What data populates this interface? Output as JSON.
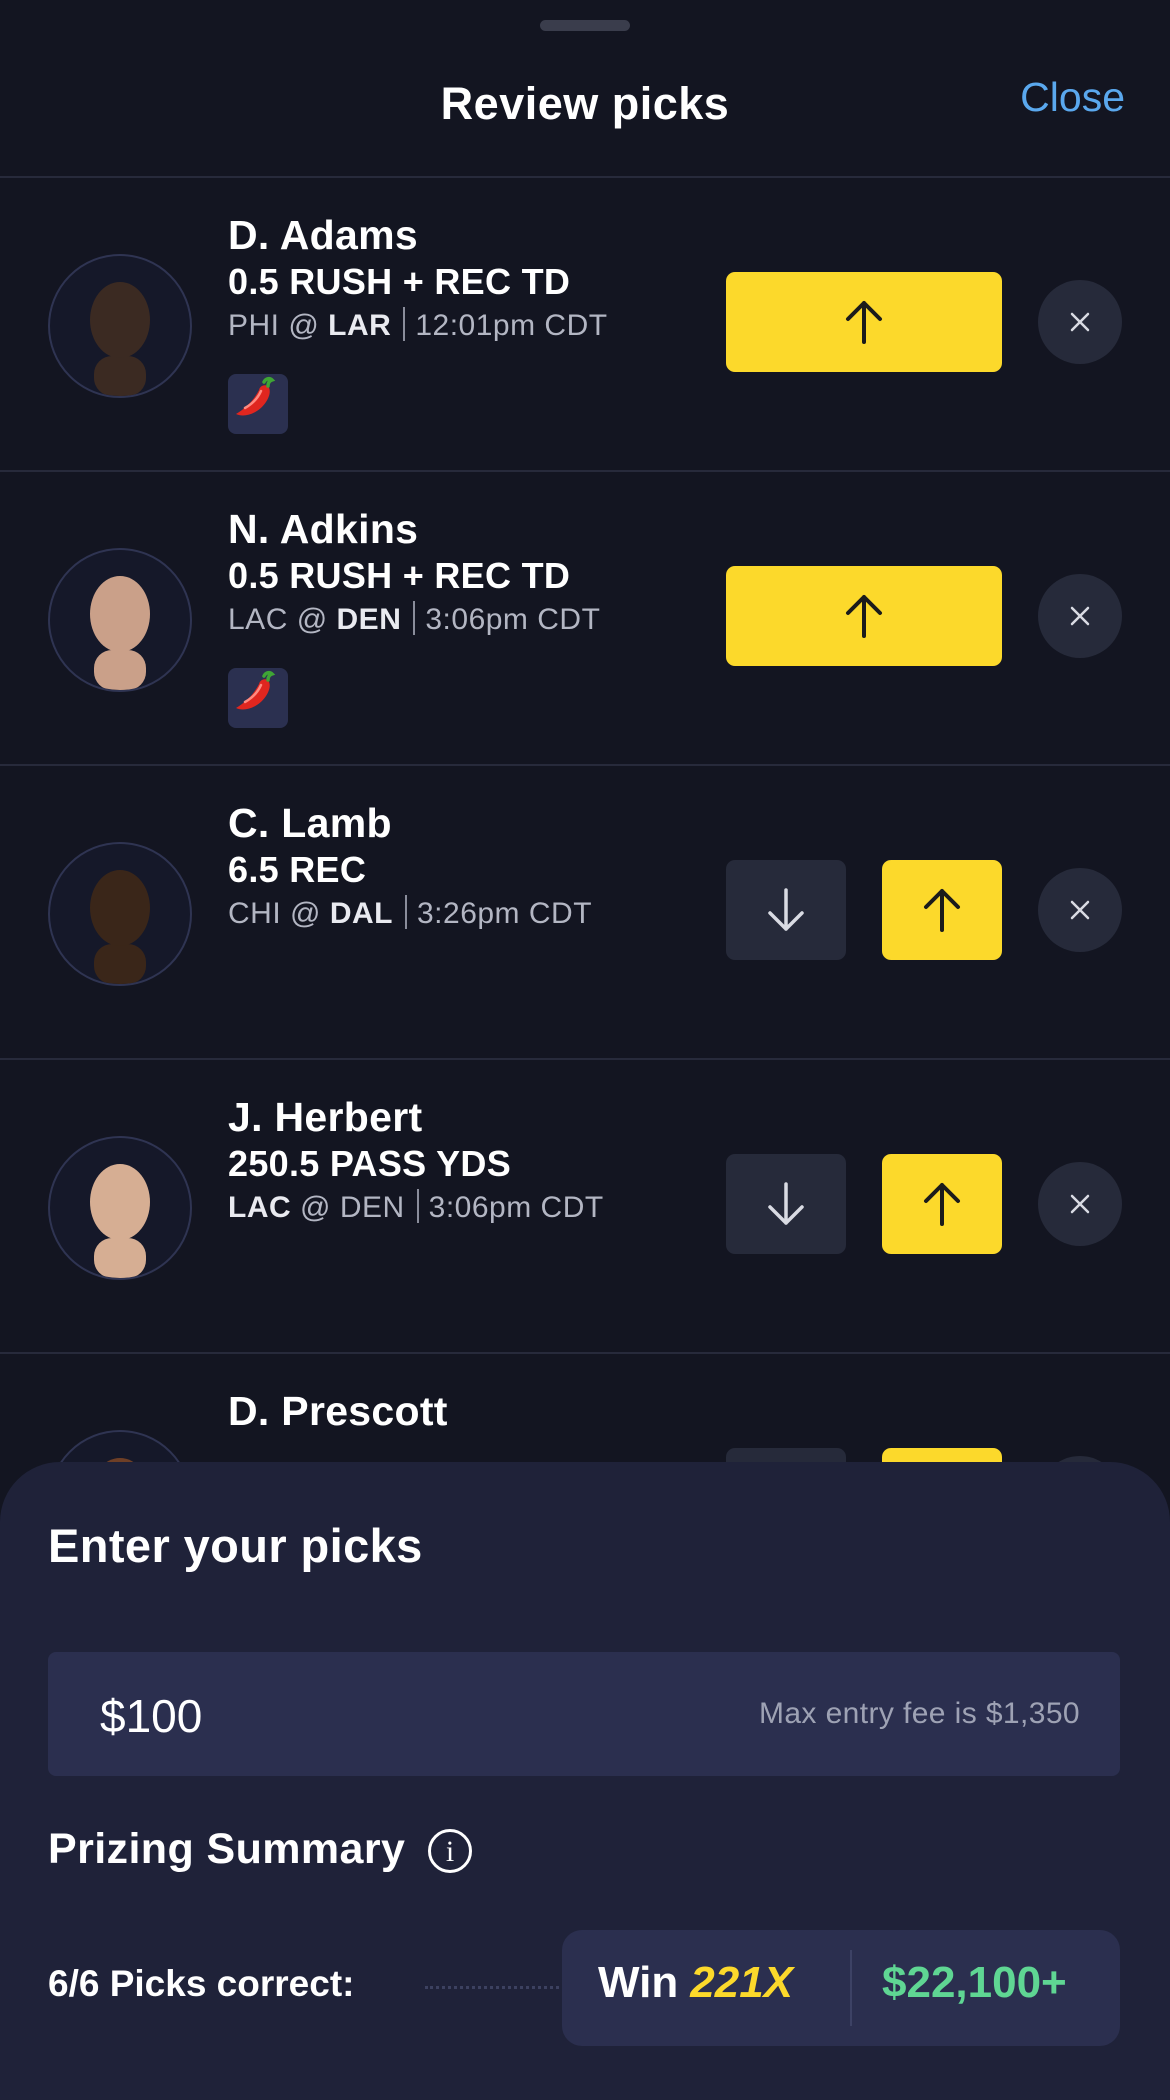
{
  "header": {
    "title": "Review picks",
    "close_label": "Close"
  },
  "picks": [
    {
      "name": "D. Adams",
      "stat": "0.5 RUSH + REC TD",
      "away": "PHI",
      "at": "@",
      "home": "LAR",
      "bold": "home",
      "time": "12:01pm CDT",
      "hot": true,
      "options": "more-only",
      "avatar_color": "#3b2a22"
    },
    {
      "name": "N. Adkins",
      "stat": "0.5 RUSH + REC TD",
      "away": "LAC",
      "at": "@",
      "home": "DEN",
      "bold": "home",
      "time": "3:06pm CDT",
      "hot": true,
      "options": "more-only",
      "avatar_color": "#caa089"
    },
    {
      "name": "C. Lamb",
      "stat": "6.5 REC",
      "away": "CHI",
      "at": "@",
      "home": "DAL",
      "bold": "home",
      "time": "3:26pm CDT",
      "hot": false,
      "options": "both",
      "avatar_color": "#3a2619"
    },
    {
      "name": "J. Herbert",
      "stat": "250.5 PASS YDS",
      "away": "LAC",
      "at": "@",
      "home": "DEN",
      "bold": "away",
      "time": "3:06pm CDT",
      "hot": false,
      "options": "both",
      "avatar_color": "#d6ae93"
    },
    {
      "name": "D. Prescott",
      "avatar_color": "#6e3f26"
    }
  ],
  "entry": {
    "title": "Enter your picks",
    "amount": "$100",
    "max_fee": "Max entry fee is $1,350"
  },
  "prizing": {
    "title": "Prizing Summary",
    "info_glyph": "i",
    "picks_label": "6/6 Picks correct:",
    "win_label": "Win",
    "multiplier": "221X",
    "payout": "$22,100+"
  },
  "colors": {
    "accent_yellow": "#fcd92b",
    "link_blue": "#5aa8ee",
    "payout_green": "#5fd693",
    "background": "#131521"
  }
}
